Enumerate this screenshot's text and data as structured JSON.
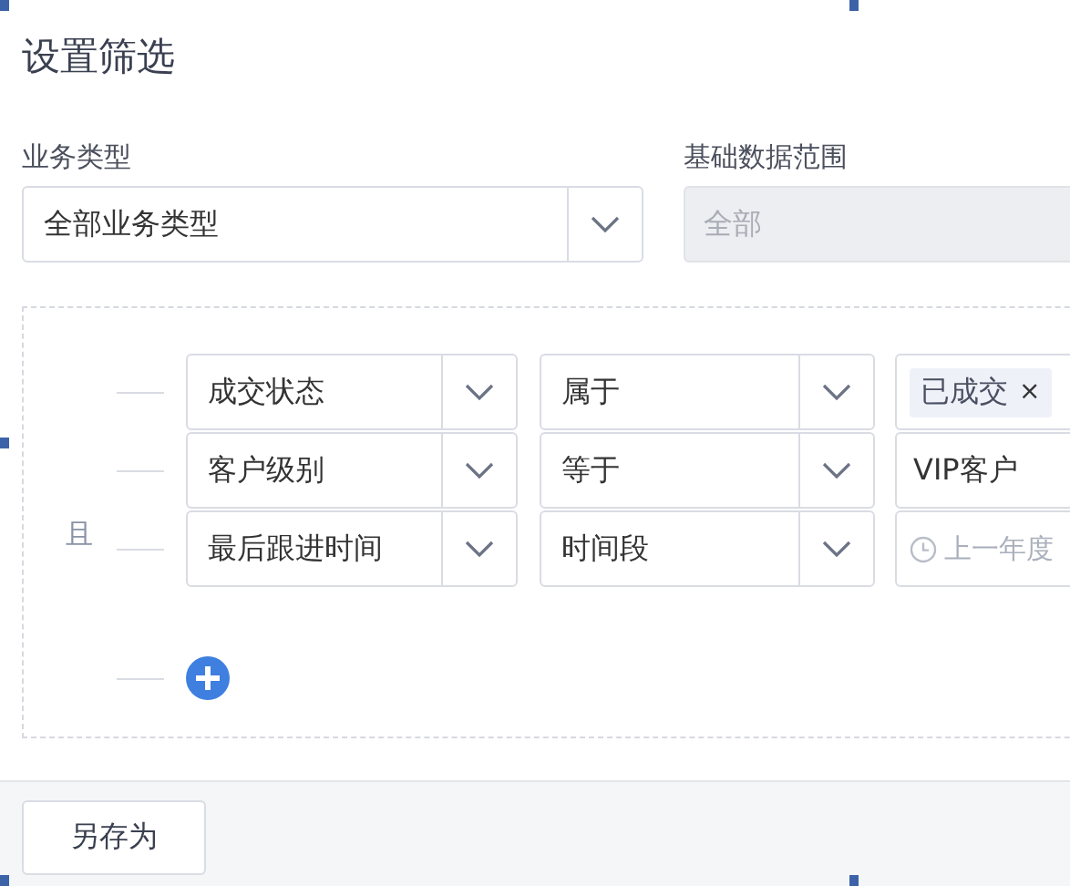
{
  "dialog": {
    "title": "设置筛选"
  },
  "business_type": {
    "label": "业务类型",
    "value": "全部业务类型"
  },
  "data_scope": {
    "label": "基础数据范围",
    "value": "全部",
    "disabled": true
  },
  "conditions": {
    "conjunction": "且",
    "rows": [
      {
        "field": "成交状态",
        "operator": "属于",
        "value": {
          "kind": "tag",
          "label": "已成交",
          "remove": "×"
        }
      },
      {
        "field": "客户级别",
        "operator": "等于",
        "value": {
          "kind": "text",
          "label": "VIP客户"
        }
      },
      {
        "field": "最后跟进时间",
        "operator": "时间段",
        "value": {
          "kind": "date",
          "placeholder": "上一年度"
        }
      }
    ]
  },
  "footer": {
    "buttons": [
      "另存为"
    ]
  }
}
